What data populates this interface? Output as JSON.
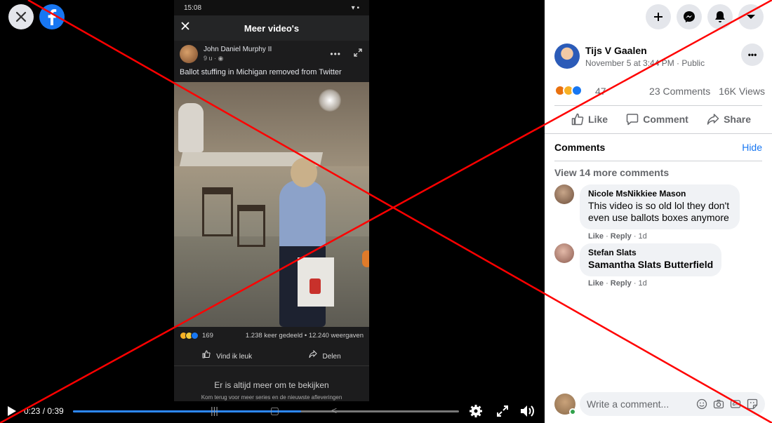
{
  "phone": {
    "status_time": "15:08",
    "header_title": "Meer video's",
    "post_author": "John Daniel Murphy II",
    "post_time": "9 u · ",
    "caption": "Ballot stuffing in Michigan removed from Twitter",
    "reaction_count": "169",
    "share_views": "1.238 keer gedeeld • 12.240 weergaven",
    "like_label": "Vind ik leuk",
    "share_label": "Delen",
    "more_title": "Er is altijd meer om te bekijken",
    "more_sub": "Kom terug voor meer series en de nieuwste afleveringen"
  },
  "player": {
    "time": "0:23 / 0:39",
    "progress": 0.59
  },
  "post": {
    "author": "Tijs V Gaalen",
    "meta": "November 5 at 3:44 PM · Public",
    "reaction_count": "47",
    "comments_count": "23 Comments",
    "views_count": "16K Views",
    "like_label": "Like",
    "comment_label": "Comment",
    "share_label": "Share"
  },
  "comments_section": {
    "title": "Comments",
    "hide_label": "Hide",
    "view_more": "View 14 more comments",
    "items": [
      {
        "name": "Nicole MsNikkiee Mason",
        "text": "This video is so old lol they don't even use ballots boxes anymore",
        "like": "Like",
        "reply": "Reply",
        "time": "1d"
      },
      {
        "name": "Stefan Slats",
        "text": "Samantha Slats Butterfield",
        "like": "Like",
        "reply": "Reply",
        "time": "1d"
      }
    ],
    "write_placeholder": "Write a comment..."
  },
  "colors": {
    "overlay_x": "#ff0000",
    "brand": "#1877f2",
    "progress": "#2d88ff"
  }
}
